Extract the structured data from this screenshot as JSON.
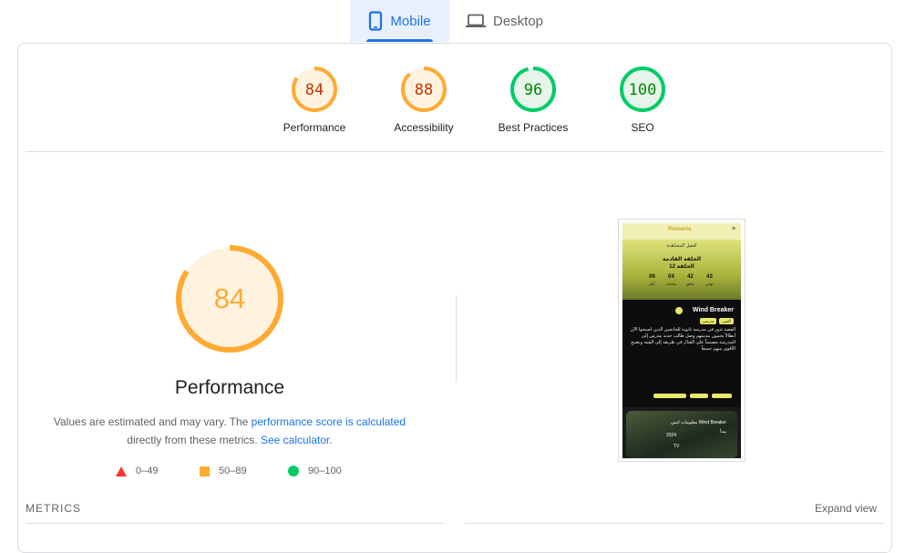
{
  "tabs": [
    {
      "label": "Mobile",
      "icon": "phone-icon",
      "active": true
    },
    {
      "label": "Desktop",
      "icon": "laptop-icon",
      "active": false
    }
  ],
  "gauges": [
    {
      "label": "Performance",
      "score": "84",
      "value": 84,
      "color": "#fa3",
      "text_color": "#c33300",
      "fill": "#fff3e0"
    },
    {
      "label": "Accessibility",
      "score": "88",
      "value": 88,
      "color": "#fa3",
      "text_color": "#c33300",
      "fill": "#fff3e0"
    },
    {
      "label": "Best Practices",
      "score": "96",
      "value": 96,
      "color": "#0c6",
      "text_color": "#080",
      "fill": "#e6f4ea"
    },
    {
      "label": "SEO",
      "score": "100",
      "value": 100,
      "color": "#0c6",
      "text_color": "#080",
      "fill": "#e6f4ea"
    }
  ],
  "performance": {
    "score": "84",
    "value": 84,
    "title": "Performance",
    "desc_prefix": "Values are estimated and may vary. The ",
    "desc_link1": "performance score is calculated",
    "desc_middle": "directly from these metrics.",
    "desc_link2": "See calculator",
    "desc_suffix": "."
  },
  "legend": [
    {
      "shape": "triangle-icon",
      "range": "0–49",
      "color": "#f33"
    },
    {
      "shape": "square-icon",
      "range": "50–89",
      "color": "#fa3"
    },
    {
      "shape": "circle-icon",
      "range": "90–100",
      "color": "#0c6"
    }
  ],
  "screenshot": {
    "logo": "Plumeria",
    "banner": "أفضل المشاهدة",
    "next_episode": "الحلقة القادمة",
    "episode": "الحلقة 12",
    "countdown": [
      {
        "num": "43",
        "unit": "ثواني"
      },
      {
        "num": "42",
        "unit": "دقائق"
      },
      {
        "num": "04",
        "unit": "ساعات"
      },
      {
        "num": "06",
        "unit": "أيام"
      }
    ],
    "show_title": "Wind Breaker",
    "badge1": "أكشن",
    "badge2": "مدرسي",
    "synopsis": "القصة تدور في مدرسة ثانوية للجانحين الذين أصبحوا الآن أبطالاً يحمون مدينتهم وصل طالب جديد مدرس إلى المدرسة مصمماً على القتال في طريقة إلى القمة ونصبح الأقوى بينهم جميعاً",
    "info_title": "معلومات انمي Wind Breaker",
    "info_status": "يبدأ",
    "info_year": "2024",
    "info_type": "TV"
  },
  "metrics": {
    "label": "METRICS",
    "expand": "Expand view"
  }
}
